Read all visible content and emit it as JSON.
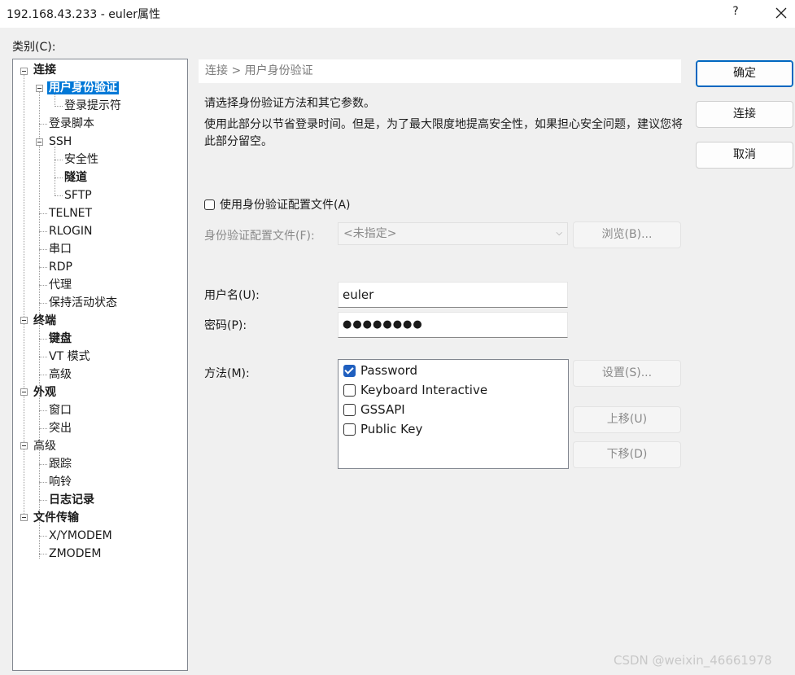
{
  "window": {
    "title": "192.168.43.233 - euler属性",
    "help_label": "?"
  },
  "category_label": "类别(C):",
  "tree": [
    {
      "label": "连接",
      "bold": true
    },
    {
      "label": "用户身份验证",
      "bold": true,
      "selected": true
    },
    {
      "label": "登录提示符"
    },
    {
      "label": "登录脚本"
    },
    {
      "label": "SSH"
    },
    {
      "label": "安全性"
    },
    {
      "label": "隧道",
      "bold": true
    },
    {
      "label": "SFTP"
    },
    {
      "label": "TELNET"
    },
    {
      "label": "RLOGIN"
    },
    {
      "label": "串口"
    },
    {
      "label": "RDP"
    },
    {
      "label": "代理"
    },
    {
      "label": "保持活动状态"
    },
    {
      "label": "终端",
      "bold": true
    },
    {
      "label": "键盘",
      "bold": true
    },
    {
      "label": "VT 模式"
    },
    {
      "label": "高级"
    },
    {
      "label": "外观",
      "bold": true
    },
    {
      "label": "窗口"
    },
    {
      "label": "突出"
    },
    {
      "label": "高级"
    },
    {
      "label": "跟踪"
    },
    {
      "label": "响铃"
    },
    {
      "label": "日志记录",
      "bold": true
    },
    {
      "label": "文件传输",
      "bold": true
    },
    {
      "label": "X/YMODEM"
    },
    {
      "label": "ZMODEM"
    }
  ],
  "breadcrumb": "连接 > 用户身份验证",
  "description": {
    "line1": "请选择身份验证方法和其它参数。",
    "line2": "使用此部分以节省登录时间。但是，为了最大限度地提高安全性，如果担心安全问题，建议您将此部分留空。"
  },
  "auth_profile": {
    "checkbox_label": "使用身份验证配置文件(A)",
    "checked": false,
    "field_label": "身份验证配置文件(F):",
    "selected": "<未指定>",
    "browse_label": "浏览(B)..."
  },
  "credentials": {
    "username_label": "用户名(U):",
    "username_value": "euler",
    "password_label": "密码(P):",
    "password_value": "●●●●●●●●"
  },
  "method": {
    "label": "方法(M):",
    "items": [
      {
        "label": "Password",
        "checked": true
      },
      {
        "label": "Keyboard Interactive",
        "checked": false
      },
      {
        "label": "GSSAPI",
        "checked": false
      },
      {
        "label": "Public Key",
        "checked": false
      }
    ],
    "settings_label": "设置(S)...",
    "move_up_label": "上移(U)",
    "move_down_label": "下移(D)"
  },
  "buttons": {
    "ok": "确定",
    "connect": "连接",
    "cancel": "取消"
  },
  "watermark": "CSDN @weixin_46661978",
  "colors": {
    "selection": "#0078d7",
    "checkbox_checked": "#1f5fbf",
    "primary_border": "#0067c0"
  }
}
